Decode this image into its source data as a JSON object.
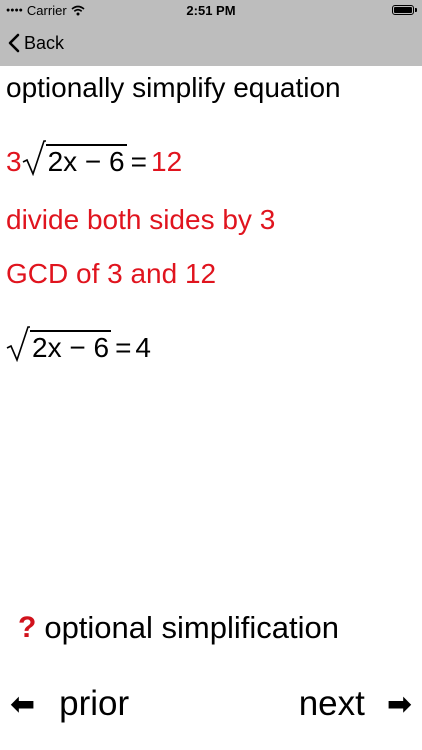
{
  "status": {
    "carrier": "Carrier",
    "time": "2:51 PM"
  },
  "nav": {
    "back_label": "Back"
  },
  "prompt": "optionally simplify equation",
  "step1": {
    "coef": "3",
    "radicand": "2x − 6",
    "equals": "=",
    "rhs": "12"
  },
  "explain1": "divide both sides by 3",
  "explain2": "GCD of 3 and 12",
  "step2": {
    "radicand": "2x − 6",
    "equals": "=",
    "rhs": "4"
  },
  "hint": {
    "icon": "?",
    "text": "optional simplification"
  },
  "footer": {
    "prior_label": "prior",
    "next_label": "next",
    "prior_icon": "⬅",
    "next_icon": "➡"
  },
  "colors": {
    "accent_red": "#e0141e",
    "bar_gray": "#bdbdbd"
  }
}
